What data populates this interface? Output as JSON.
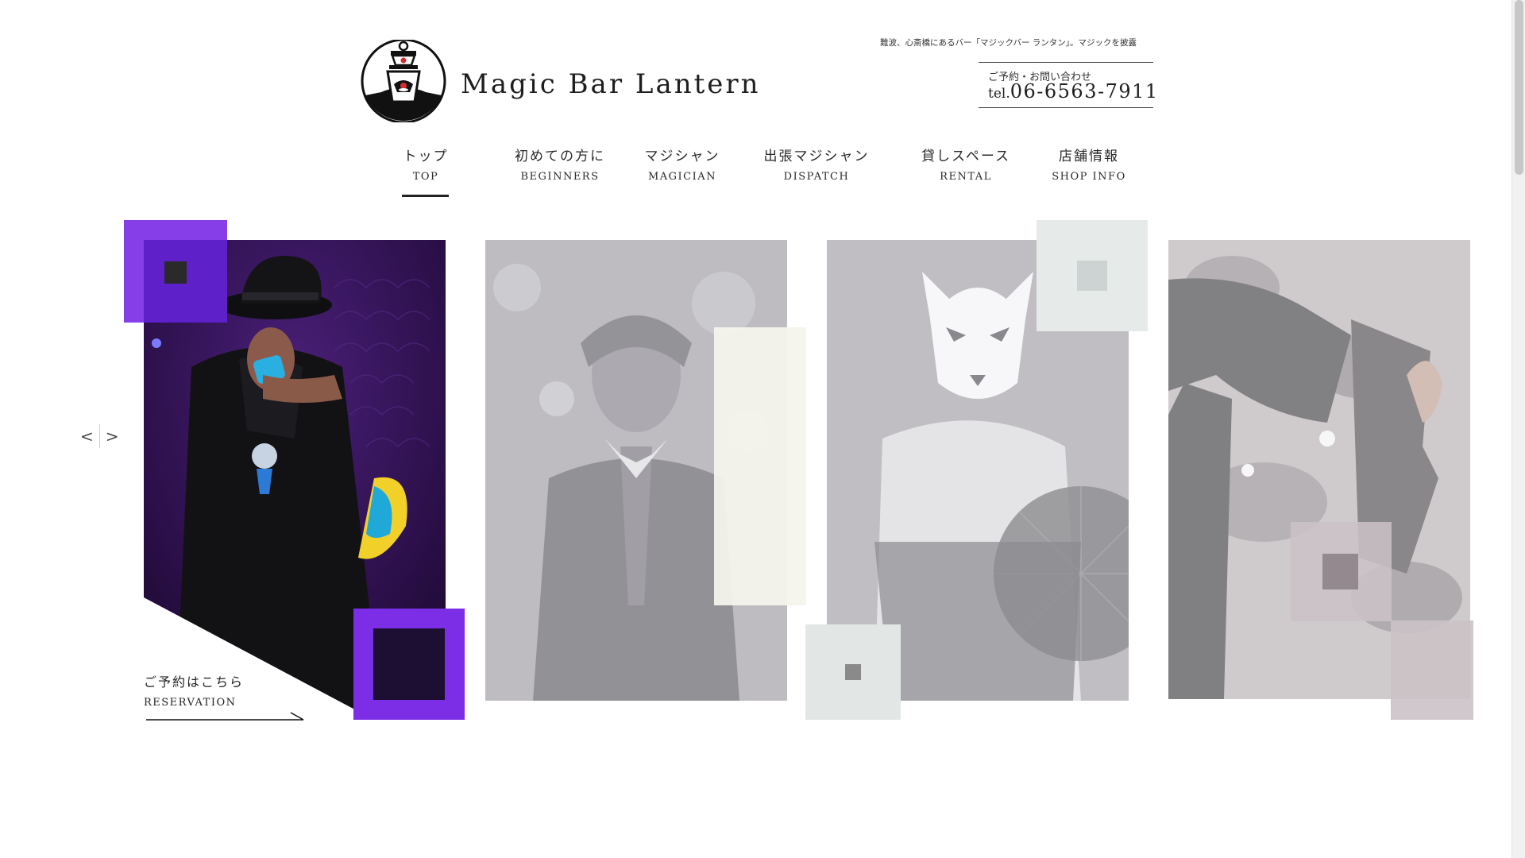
{
  "header": {
    "brand": "Magic Bar Lantern",
    "tagline": "難波、心斎橋にあるバー「マジックバー ランタン」。マジックを披露",
    "contact_label": "ご予約・お問い合わせ",
    "tel_prefix": "tel.",
    "tel_number": "06-6563-7911"
  },
  "nav": {
    "active": "top",
    "items": [
      {
        "jp": "トップ",
        "en": "TOP"
      },
      {
        "jp": "初めての方に",
        "en": "BEGINNERS"
      },
      {
        "jp": "マジシャン",
        "en": "MAGICIAN"
      },
      {
        "jp": "出張マジシャン",
        "en": "DISPATCH"
      },
      {
        "jp": "貸しスペース",
        "en": "RENTAL"
      },
      {
        "jp": "店舗情報",
        "en": "SHOP INFO"
      }
    ]
  },
  "slider": {
    "prev_label": "<",
    "next_label": ">"
  },
  "cards": [
    {
      "icon": "magician-with-fan-photo",
      "accent": "#7b2ee6",
      "state": "active"
    },
    {
      "icon": "magician-in-suit-photo",
      "accent": "#f4f4ec",
      "state": "faded"
    },
    {
      "icon": "fox-mask-magician-photo",
      "accent": "#e6ebea",
      "state": "faded"
    },
    {
      "icon": "magician-with-cloth-photo",
      "accent": "#cbc2c7",
      "state": "faded"
    }
  ],
  "reservation": {
    "jp": "ご予約はこちら",
    "en": "RESERVATION"
  },
  "colors": {
    "accent_purple": "#7b2ee6",
    "text": "#222222",
    "background": "#ffffff"
  }
}
